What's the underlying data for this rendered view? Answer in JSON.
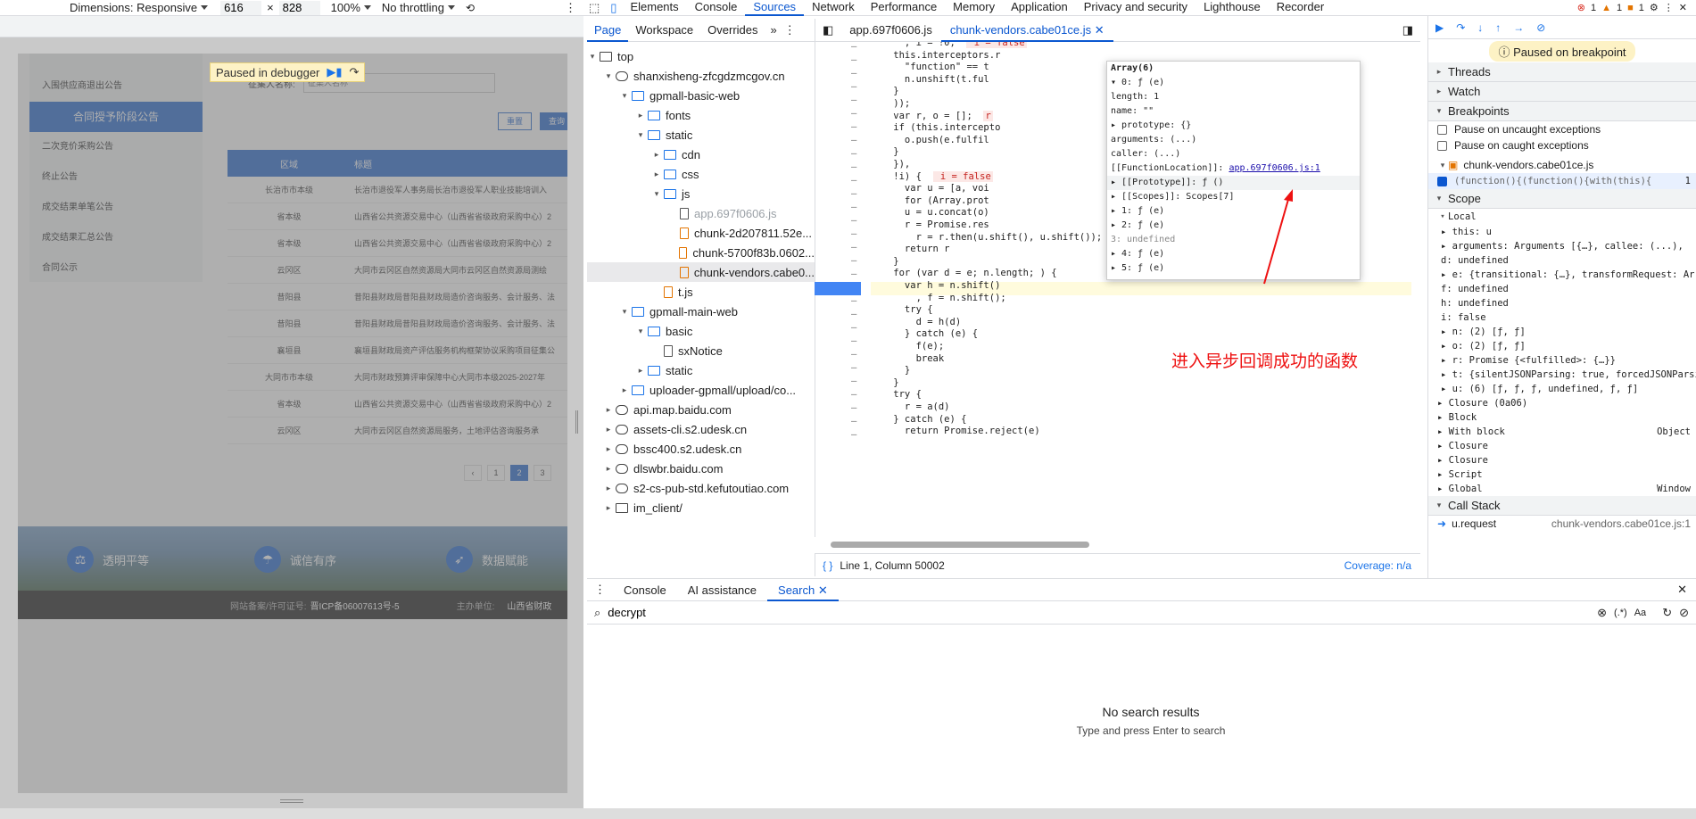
{
  "device_toolbar": {
    "dimensions_label": "Dimensions: Responsive",
    "width": "616",
    "times": "×",
    "height": "828",
    "zoom": "100%",
    "throttling": "No throttling"
  },
  "page": {
    "side_menu": [
      "入围供应商退出公告",
      "合同授予阶段公告",
      "二次竞价采购公告",
      "终止公告",
      "成交结果单笔公告",
      "成交结果汇总公告",
      "合同公示"
    ],
    "side_menu_active": 1,
    "search_label": "征集人名称:",
    "search_placeholder": "征集人名称",
    "reset_btn": "重置",
    "query_btn": "查询",
    "table_headers": [
      "区域",
      "标题"
    ],
    "rows": [
      [
        "长治市市本级",
        "长治市退役军人事务局长治市退役军人职业技能培训入"
      ],
      [
        "省本级",
        "山西省公共资源交易中心（山西省省级政府采购中心）2"
      ],
      [
        "省本级",
        "山西省公共资源交易中心（山西省省级政府采购中心）2"
      ],
      [
        "云冈区",
        "大同市云冈区自然资源局大同市云冈区自然资源局测绘"
      ],
      [
        "昔阳县",
        "昔阳县财政局昔阳县财政局造价咨询服务、会计服务、法"
      ],
      [
        "昔阳县",
        "昔阳县财政局昔阳县财政局造价咨询服务、会计服务、法"
      ],
      [
        "襄垣县",
        "襄垣县财政局资产评估服务机构框架协议采购项目征集公"
      ],
      [
        "大同市市本级",
        "大同市财政预算评审保障中心大同市本级2025-2027年"
      ],
      [
        "省本级",
        "山西省公共资源交易中心（山西省省级政府采购中心）2"
      ],
      [
        "云冈区",
        "大同市云冈区自然资源局服务，土地评估咨询服务承"
      ]
    ],
    "pager": [
      "‹",
      "1",
      "2",
      "3"
    ],
    "pager_active": 2,
    "banner_items": [
      "透明平等",
      "诚信有序",
      "数据赋能"
    ],
    "footer_left": "网站备案/许可证号:",
    "footer_icp": "晋ICP备06007613号-5",
    "footer_right": "主办单位:",
    "footer_org": "山西省财政",
    "paused_label": "Paused in debugger"
  },
  "devtools_tabs": [
    "Elements",
    "Console",
    "Sources",
    "Network",
    "Performance",
    "Memory",
    "Application",
    "Privacy and security",
    "Lighthouse",
    "Recorder"
  ],
  "devtools_active_tab": "Sources",
  "badges": {
    "errors": "1",
    "warnings": "1",
    "issues": "1"
  },
  "navigator": {
    "tabs": [
      "Page",
      "Workspace",
      "Overrides"
    ],
    "tree": [
      {
        "label": "top",
        "depth": 0,
        "icon": "window",
        "open": true
      },
      {
        "label": "shanxisheng-zfcgdzmcgov.cn",
        "depth": 1,
        "icon": "cloud",
        "open": true
      },
      {
        "label": "gpmall-basic-web",
        "depth": 2,
        "icon": "folder",
        "open": true
      },
      {
        "label": "fonts",
        "depth": 3,
        "icon": "folder",
        "open": false
      },
      {
        "label": "static",
        "depth": 3,
        "icon": "folder",
        "open": true
      },
      {
        "label": "cdn",
        "depth": 4,
        "icon": "folder",
        "open": false
      },
      {
        "label": "css",
        "depth": 4,
        "icon": "folder",
        "open": false
      },
      {
        "label": "js",
        "depth": 4,
        "icon": "folder",
        "open": true
      },
      {
        "label": "app.697f0606.js",
        "depth": 5,
        "icon": "file-gray",
        "muted": true
      },
      {
        "label": "chunk-2d207811.52e...",
        "depth": 5,
        "icon": "file"
      },
      {
        "label": "chunk-5700f83b.0602...",
        "depth": 5,
        "icon": "file"
      },
      {
        "label": "chunk-vendors.cabe0...",
        "depth": 5,
        "icon": "file",
        "selected": true
      },
      {
        "label": "t.js",
        "depth": 4,
        "icon": "file"
      },
      {
        "label": "gpmall-main-web",
        "depth": 2,
        "icon": "folder",
        "open": true
      },
      {
        "label": "basic",
        "depth": 3,
        "icon": "folder",
        "open": true
      },
      {
        "label": "sxNotice",
        "depth": 4,
        "icon": "file-gray"
      },
      {
        "label": "static",
        "depth": 3,
        "icon": "folder",
        "open": false
      },
      {
        "label": "uploader-gpmall/upload/co...",
        "depth": 2,
        "icon": "folder",
        "open": false
      },
      {
        "label": "api.map.baidu.com",
        "depth": 1,
        "icon": "cloud",
        "open": false
      },
      {
        "label": "assets-cli.s2.udesk.cn",
        "depth": 1,
        "icon": "cloud",
        "open": false
      },
      {
        "label": "bssc400.s2.udesk.cn",
        "depth": 1,
        "icon": "cloud",
        "open": false
      },
      {
        "label": "dlswbr.baidu.com",
        "depth": 1,
        "icon": "cloud",
        "open": false
      },
      {
        "label": "s2-cs-pub-std.kefutoutiao.com",
        "depth": 1,
        "icon": "cloud",
        "open": false
      },
      {
        "label": "im_client/",
        "depth": 1,
        "icon": "window",
        "open": false
      }
    ]
  },
  "editor": {
    "tabs": [
      "app.697f0606.js",
      "chunk-vendors.cabe01ce.js"
    ],
    "active_tab": 1,
    "status": "Line 1, Column 50002",
    "coverage": "Coverage: n/a",
    "annotation": "进入异步回调成功的函数"
  },
  "popover": {
    "title": "Array(6)",
    "lines": [
      "▾ 0: ƒ (e)",
      "    length: 1",
      "    name: \"\"",
      "  ▸ prototype: {}",
      "    arguments: (...)",
      "    caller: (...)",
      "    [[FunctionLocation]]: ",
      "  ▸ [[Prototype]]: ƒ ()",
      "  ▸ [[Scopes]]: Scopes[7]",
      "▸ 1: ƒ (e)",
      "▸ 2: ƒ (e)",
      "  3: undefined",
      "▸ 4: ƒ (e)",
      "▸ 5: ƒ (e)"
    ],
    "link": "app.697f0606.js:1"
  },
  "drawer": {
    "tabs": [
      "Console",
      "AI assistance",
      "Search"
    ],
    "active_tab": 2,
    "query": "decrypt",
    "regex": "(.*)",
    "case": "Aa",
    "no_results": "No search results",
    "hint": "Type and press Enter to search"
  },
  "debugger": {
    "paused": "Paused on breakpoint",
    "sections": [
      "Threads",
      "Watch",
      "Breakpoints"
    ],
    "pause_uncaught": "Pause on uncaught exceptions",
    "pause_caught": "Pause on caught exceptions",
    "bp_file": "chunk-vendors.cabe01ce.js",
    "bp_code": "(function(){(function(){with(this){",
    "bp_line": "1",
    "scope_title": "Scope",
    "local": "Local",
    "scope_lines": [
      "▸ this: u",
      "▸ arguments: Arguments [{…}, callee: (...),",
      "  d: undefined",
      "▸ e: {transitional: {…}, transformRequest: Arr",
      "  f: undefined",
      "  h: undefined",
      "  i: false",
      "▸ n: (2) [ƒ, ƒ]",
      "▸ o: (2) [ƒ, ƒ]",
      "▸ r: Promise {<fulfilled>: {…}}",
      "▸ t: {silentJSONParsing: true, forcedJSONParsin",
      "▸ u: (6) [ƒ, ƒ, ƒ, undefined, ƒ, ƒ]"
    ],
    "closures": [
      "Closure (0a06)",
      "Block",
      "With block",
      "Closure",
      "Closure",
      "Script",
      "Global"
    ],
    "with_block_val": "Object",
    "global_val": "Window",
    "call_stack": "Call Stack",
    "stack_fn": "u.request",
    "stack_loc": "chunk-vendors.cabe01ce.js:1"
  }
}
